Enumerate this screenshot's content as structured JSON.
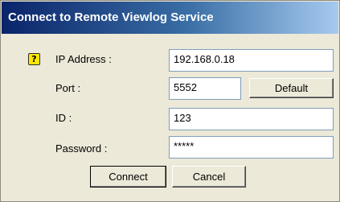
{
  "window": {
    "title": "Connect to Remote Viewlog Service"
  },
  "form": {
    "ip_label": "IP Address :",
    "ip_value": "192.168.0.18",
    "port_label": "Port :",
    "port_value": "5552",
    "default_label": "Default",
    "id_label": "ID :",
    "id_value": "123",
    "password_label": "Password :",
    "password_value": "*****"
  },
  "buttons": {
    "connect_label": "Connect",
    "cancel_label": "Cancel"
  },
  "icons": {
    "help": "?"
  },
  "colors": {
    "title_start": "#0a246a",
    "title_end": "#a6caf0",
    "dialog_bg": "#ece9d8",
    "help_icon": "#ffe600"
  }
}
